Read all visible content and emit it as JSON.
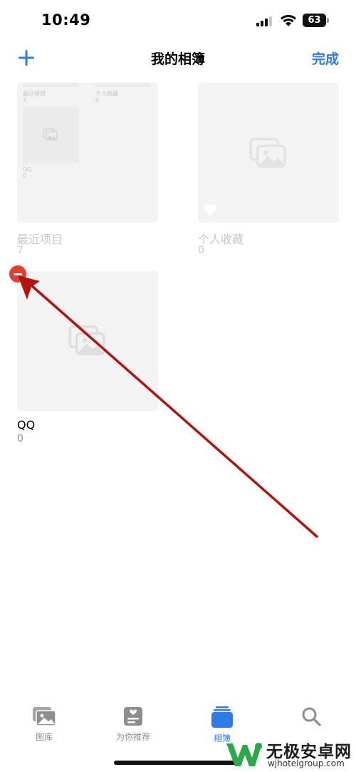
{
  "status_bar": {
    "time": "10:49",
    "battery": "63"
  },
  "nav": {
    "title": "我的相簿",
    "done_label": "完成",
    "add_icon": "plus-icon"
  },
  "albums": [
    {
      "name": "最近项目",
      "count": "7",
      "faded": true,
      "preview": {
        "tiles": [
          {
            "name": "最近项目",
            "count": "7"
          },
          {
            "name": "个人收藏",
            "count": "0"
          },
          {
            "name": "QQ",
            "count": "0"
          }
        ]
      }
    },
    {
      "name": "个人收藏",
      "count": "0",
      "faded": true
    },
    {
      "name": "QQ",
      "count": "0",
      "faded": false
    }
  ],
  "tabs": [
    {
      "label": "图库",
      "icon": "photo-library-icon",
      "active": false
    },
    {
      "label": "为你推荐",
      "icon": "for-you-icon",
      "active": false
    },
    {
      "label": "相簿",
      "icon": "albums-icon",
      "active": true
    },
    {
      "label": "",
      "icon": "search-icon",
      "active": false
    }
  ],
  "colors": {
    "accent": "#2f7bea",
    "delete": "#e53d30",
    "arrow": "#b3140e"
  },
  "watermark": {
    "text": "无极安卓网",
    "url": "wjhotelgroup.com"
  }
}
